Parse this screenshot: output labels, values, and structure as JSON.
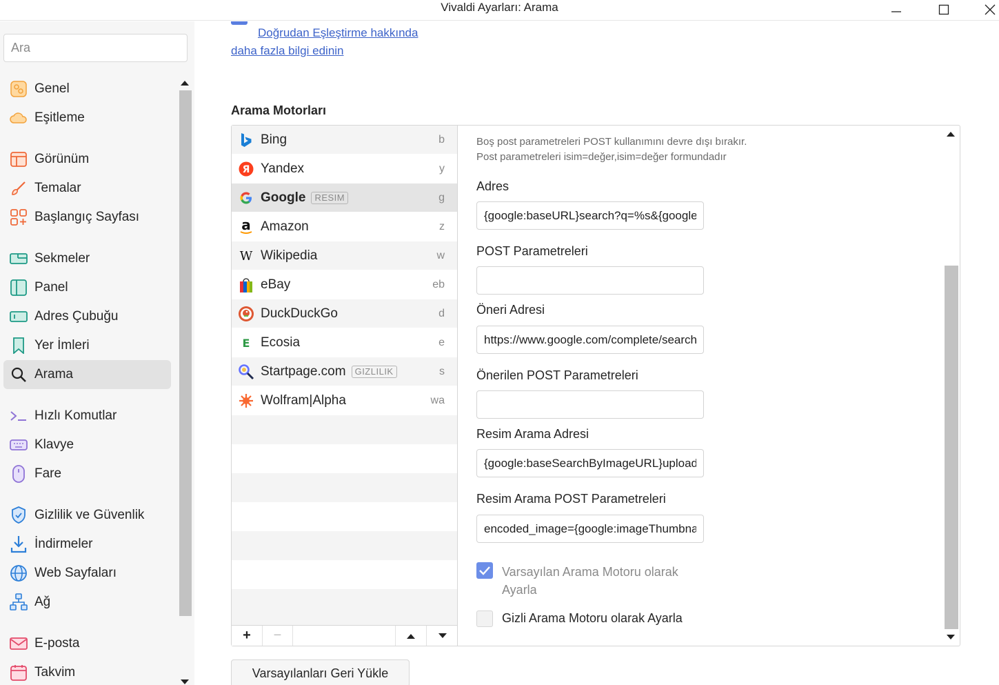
{
  "window": {
    "title": "Vivaldi Ayarları: Arama"
  },
  "sidebar": {
    "search_placeholder": "Ara",
    "items": [
      {
        "label": "Genel",
        "icon": "general-icon"
      },
      {
        "label": "Eşitleme",
        "icon": "cloud-icon"
      },
      {
        "label": "Görünüm",
        "icon": "appearance-icon"
      },
      {
        "label": "Temalar",
        "icon": "brush-icon"
      },
      {
        "label": "Başlangıç Sayfası",
        "icon": "start-page-icon"
      },
      {
        "label": "Sekmeler",
        "icon": "tabs-icon"
      },
      {
        "label": "Panel",
        "icon": "panel-icon"
      },
      {
        "label": "Adres Çubuğu",
        "icon": "address-bar-icon"
      },
      {
        "label": "Yer İmleri",
        "icon": "bookmark-icon"
      },
      {
        "label": "Arama",
        "icon": "search-icon"
      },
      {
        "label": "Hızlı Komutlar",
        "icon": "quick-commands-icon"
      },
      {
        "label": "Klavye",
        "icon": "keyboard-icon"
      },
      {
        "label": "Fare",
        "icon": "mouse-icon"
      },
      {
        "label": "Gizlilik ve Güvenlik",
        "icon": "shield-icon"
      },
      {
        "label": "İndirmeler",
        "icon": "download-icon"
      },
      {
        "label": "Web Sayfaları",
        "icon": "globe-icon"
      },
      {
        "label": "Ağ",
        "icon": "network-icon"
      },
      {
        "label": "E-posta",
        "icon": "mail-icon"
      },
      {
        "label": "Takvim",
        "icon": "calendar-icon"
      }
    ],
    "active": "Arama"
  },
  "main": {
    "links": {
      "direct_match": "Doğrudan Eşleştirme hakkında",
      "learn_more": "daha fazla bilgi edinin"
    },
    "section_title": "Arama Motorları",
    "engines": [
      {
        "name": "Bing",
        "keyword": "b",
        "badge": "",
        "icon": "bing-icon"
      },
      {
        "name": "Yandex",
        "keyword": "y",
        "badge": "",
        "icon": "yandex-icon"
      },
      {
        "name": "Google",
        "keyword": "g",
        "badge": "RESIM",
        "icon": "google-icon",
        "selected": true
      },
      {
        "name": "Amazon",
        "keyword": "z",
        "badge": "",
        "icon": "amazon-icon"
      },
      {
        "name": "Wikipedia",
        "keyword": "w",
        "badge": "",
        "icon": "wikipedia-icon"
      },
      {
        "name": "eBay",
        "keyword": "eb",
        "badge": "",
        "icon": "ebay-icon"
      },
      {
        "name": "DuckDuckGo",
        "keyword": "d",
        "badge": "",
        "icon": "duckduckgo-icon"
      },
      {
        "name": "Ecosia",
        "keyword": "e",
        "badge": "",
        "icon": "ecosia-icon"
      },
      {
        "name": "Startpage.com",
        "keyword": "s",
        "badge": "GIZLILIK",
        "icon": "startpage-icon"
      },
      {
        "name": "Wolfram|Alpha",
        "keyword": "wa",
        "badge": "",
        "icon": "wolfram-icon"
      }
    ],
    "toolbar": {
      "add": "+",
      "remove": "−"
    },
    "details": {
      "hint1": "Boş post parametreleri POST kullanımını devre dışı bırakır.",
      "hint2": "Post parametreleri isim=değer,isim=değer formundadır",
      "address_label": "Adres",
      "address_value": "{google:baseURL}search?q=%s&{google:RLZ}",
      "post_label": "POST Parametreleri",
      "post_value": "",
      "suggest_label": "Öneri Adresi",
      "suggest_value": "https://www.google.com/complete/search",
      "suggest_post_label": "Önerilen POST Parametreleri",
      "suggest_post_value": "",
      "image_label": "Resim Arama Adresi",
      "image_value": "{google:baseSearchByImageURL}upload",
      "image_post_label": "Resim Arama POST Parametreleri",
      "image_post_value": "encoded_image={google:imageThumbnail}",
      "default_label": "Varsayılan Arama Motoru olarak Ayarla",
      "default_checked": true,
      "private_label": "Gizli Arama Motoru olarak Ayarla",
      "private_checked": false
    },
    "restore_button": "Varsayılanları Geri Yükle"
  },
  "colors": {
    "accent": "#6c8ee8",
    "link": "#3d63c9",
    "sidebar_bg": "#f6f6f6",
    "active_bg": "#e2e2e2"
  }
}
